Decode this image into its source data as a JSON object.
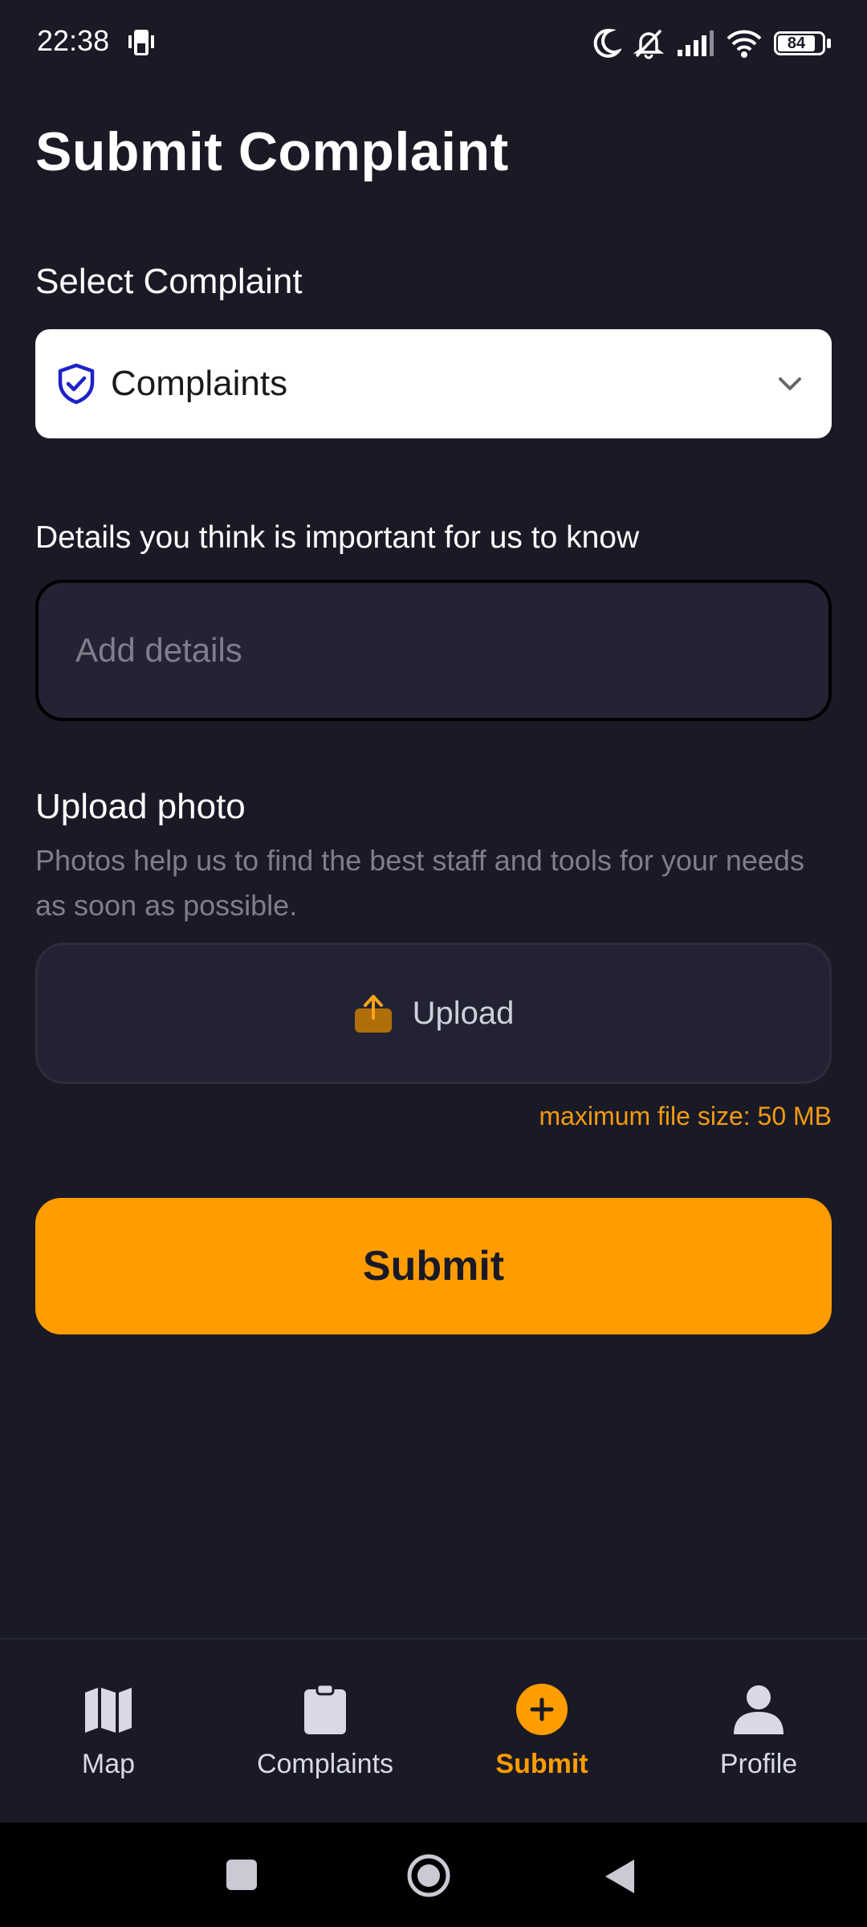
{
  "status_bar": {
    "time": "22:38",
    "battery": "84",
    "icons": [
      "moon-icon",
      "bell-off-icon",
      "signal-icon",
      "wifi-icon",
      "battery-icon"
    ]
  },
  "page": {
    "title": "Submit Complaint"
  },
  "complaint_select": {
    "label": "Select Complaint",
    "value": "Complaints",
    "icon": "shield-check-icon"
  },
  "details": {
    "label": "Details you think is important for us to know",
    "placeholder": "Add details",
    "value": ""
  },
  "upload": {
    "label": "Upload photo",
    "description": "Photos help us to find the best staff and tools for your needs as soon as possible.",
    "button_label": "Upload",
    "max_size": "maximum file size: 50 MB"
  },
  "submit": {
    "label": "Submit"
  },
  "bottom_nav": {
    "items": [
      {
        "label": "Map",
        "icon": "map-icon",
        "active": false
      },
      {
        "label": "Complaints",
        "icon": "clipboard-icon",
        "active": false
      },
      {
        "label": "Submit",
        "icon": "plus-circle-icon",
        "active": true
      },
      {
        "label": "Profile",
        "icon": "person-icon",
        "active": false
      }
    ]
  },
  "colors": {
    "background": "#1a1a26",
    "accent": "#ff9d00",
    "field_background": "#232334",
    "muted_text": "#7e7e8c"
  }
}
